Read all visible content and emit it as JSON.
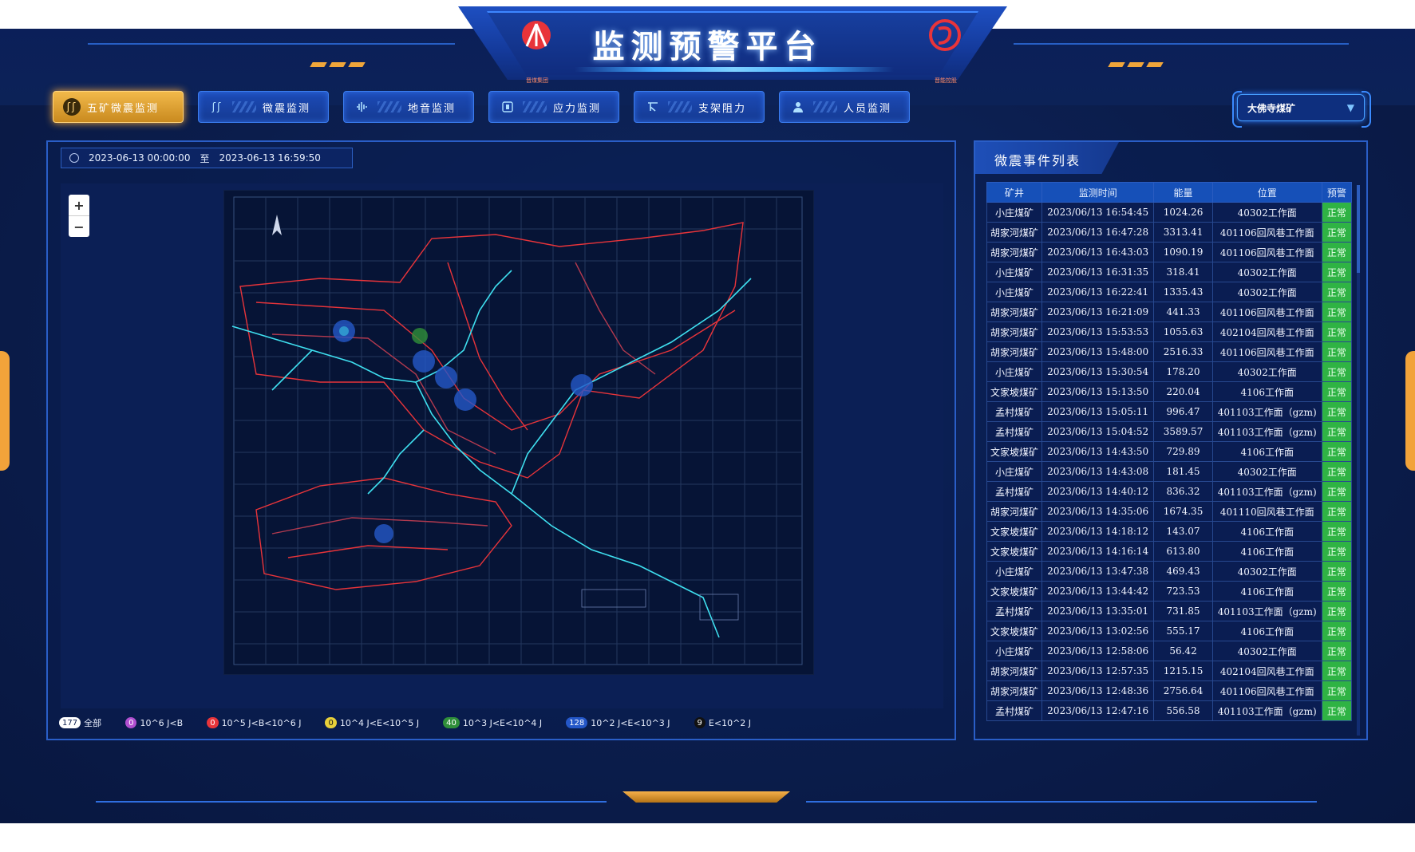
{
  "header": {
    "title": "监测预警平台",
    "logo_left_caption": "晋煤集团",
    "logo_right_caption": "晋能控股"
  },
  "nav": {
    "items": [
      {
        "label": "五矿微震监测",
        "icon": "ss-icon",
        "active": true
      },
      {
        "label": "微震监测",
        "icon": "ss-icon",
        "active": false
      },
      {
        "label": "地音监测",
        "icon": "waveform-icon",
        "active": false
      },
      {
        "label": "应力监测",
        "icon": "gauge-icon",
        "active": false
      },
      {
        "label": "支架阻力",
        "icon": "support-icon",
        "active": false
      },
      {
        "label": "人员监测",
        "icon": "person-icon",
        "active": false
      }
    ]
  },
  "mine_select": {
    "value": "大佛寺煤矿"
  },
  "date_range": {
    "start": "2023-06-13 00:00:00",
    "separator": "至",
    "end": "2023-06-13 16:59:50"
  },
  "map": {
    "zoom_in": "+",
    "zoom_out": "−"
  },
  "legend": [
    {
      "count": "177",
      "label": "全部",
      "color": "#ffffff",
      "text_color": "#0b1d4c"
    },
    {
      "count": "0",
      "label": "10^6 J<B",
      "color": "#b04fd0",
      "text_color": "#ffffff"
    },
    {
      "count": "0",
      "label": "10^5 J<B<10^6 J",
      "color": "#e8343a",
      "text_color": "#ffffff"
    },
    {
      "count": "0",
      "label": "10^4 J<E<10^5 J",
      "color": "#e8d03a",
      "text_color": "#1a1a1a"
    },
    {
      "count": "40",
      "label": "10^3 J<E<10^4 J",
      "color": "#2f8f3a",
      "text_color": "#ffffff"
    },
    {
      "count": "128",
      "label": "10^2 J<E<10^3 J",
      "color": "#2457c8",
      "text_color": "#ffffff"
    },
    {
      "count": "9",
      "label": "E<10^2 J",
      "color": "#111111",
      "text_color": "#ffffff"
    }
  ],
  "events": {
    "title": "微震事件列表",
    "columns": [
      "矿井",
      "监测时间",
      "能量",
      "位置",
      "预警"
    ],
    "rows": [
      [
        "小庄煤矿",
        "2023/06/13 16:54:45",
        "1024.26",
        "40302工作面",
        "正常"
      ],
      [
        "胡家河煤矿",
        "2023/06/13 16:47:28",
        "3313.41",
        "401106回风巷工作面",
        "正常"
      ],
      [
        "胡家河煤矿",
        "2023/06/13 16:43:03",
        "1090.19",
        "401106回风巷工作面",
        "正常"
      ],
      [
        "小庄煤矿",
        "2023/06/13 16:31:35",
        "318.41",
        "40302工作面",
        "正常"
      ],
      [
        "小庄煤矿",
        "2023/06/13 16:22:41",
        "1335.43",
        "40302工作面",
        "正常"
      ],
      [
        "胡家河煤矿",
        "2023/06/13 16:21:09",
        "441.33",
        "401106回风巷工作面",
        "正常"
      ],
      [
        "胡家河煤矿",
        "2023/06/13 15:53:53",
        "1055.63",
        "402104回风巷工作面",
        "正常"
      ],
      [
        "胡家河煤矿",
        "2023/06/13 15:48:00",
        "2516.33",
        "401106回风巷工作面",
        "正常"
      ],
      [
        "小庄煤矿",
        "2023/06/13 15:30:54",
        "178.20",
        "40302工作面",
        "正常"
      ],
      [
        "文家坡煤矿",
        "2023/06/13 15:13:50",
        "220.04",
        "4106工作面",
        "正常"
      ],
      [
        "孟村煤矿",
        "2023/06/13 15:05:11",
        "996.47",
        "401103工作面（gzm)",
        "正常"
      ],
      [
        "孟村煤矿",
        "2023/06/13 15:04:52",
        "3589.57",
        "401103工作面（gzm)",
        "正常"
      ],
      [
        "文家坡煤矿",
        "2023/06/13 14:43:50",
        "729.89",
        "4106工作面",
        "正常"
      ],
      [
        "小庄煤矿",
        "2023/06/13 14:43:08",
        "181.45",
        "40302工作面",
        "正常"
      ],
      [
        "孟村煤矿",
        "2023/06/13 14:40:12",
        "836.32",
        "401103工作面（gzm)",
        "正常"
      ],
      [
        "胡家河煤矿",
        "2023/06/13 14:35:06",
        "1674.35",
        "401110回风巷工作面",
        "正常"
      ],
      [
        "文家坡煤矿",
        "2023/06/13 14:18:12",
        "143.07",
        "4106工作面",
        "正常"
      ],
      [
        "文家坡煤矿",
        "2023/06/13 14:16:14",
        "613.80",
        "4106工作面",
        "正常"
      ],
      [
        "小庄煤矿",
        "2023/06/13 13:47:38",
        "469.43",
        "40302工作面",
        "正常"
      ],
      [
        "文家坡煤矿",
        "2023/06/13 13:44:42",
        "723.53",
        "4106工作面",
        "正常"
      ],
      [
        "孟村煤矿",
        "2023/06/13 13:35:01",
        "731.85",
        "401103工作面（gzm)",
        "正常"
      ],
      [
        "文家坡煤矿",
        "2023/06/13 13:02:56",
        "555.17",
        "4106工作面",
        "正常"
      ],
      [
        "小庄煤矿",
        "2023/06/13 12:58:06",
        "56.42",
        "40302工作面",
        "正常"
      ],
      [
        "胡家河煤矿",
        "2023/06/13 12:57:35",
        "1215.15",
        "402104回风巷工作面",
        "正常"
      ],
      [
        "胡家河煤矿",
        "2023/06/13 12:48:36",
        "2756.64",
        "401106回风巷工作面",
        "正常"
      ],
      [
        "孟村煤矿",
        "2023/06/13 12:47:16",
        "556.58",
        "401103工作面（gzm)",
        "正常"
      ]
    ]
  },
  "colors": {
    "accent": "#f2a33a",
    "panel_border": "#2a5ec7",
    "status_ok": "#2fb344",
    "map_line_red": "#e8343a",
    "map_line_cyan": "#3fe0f0"
  }
}
